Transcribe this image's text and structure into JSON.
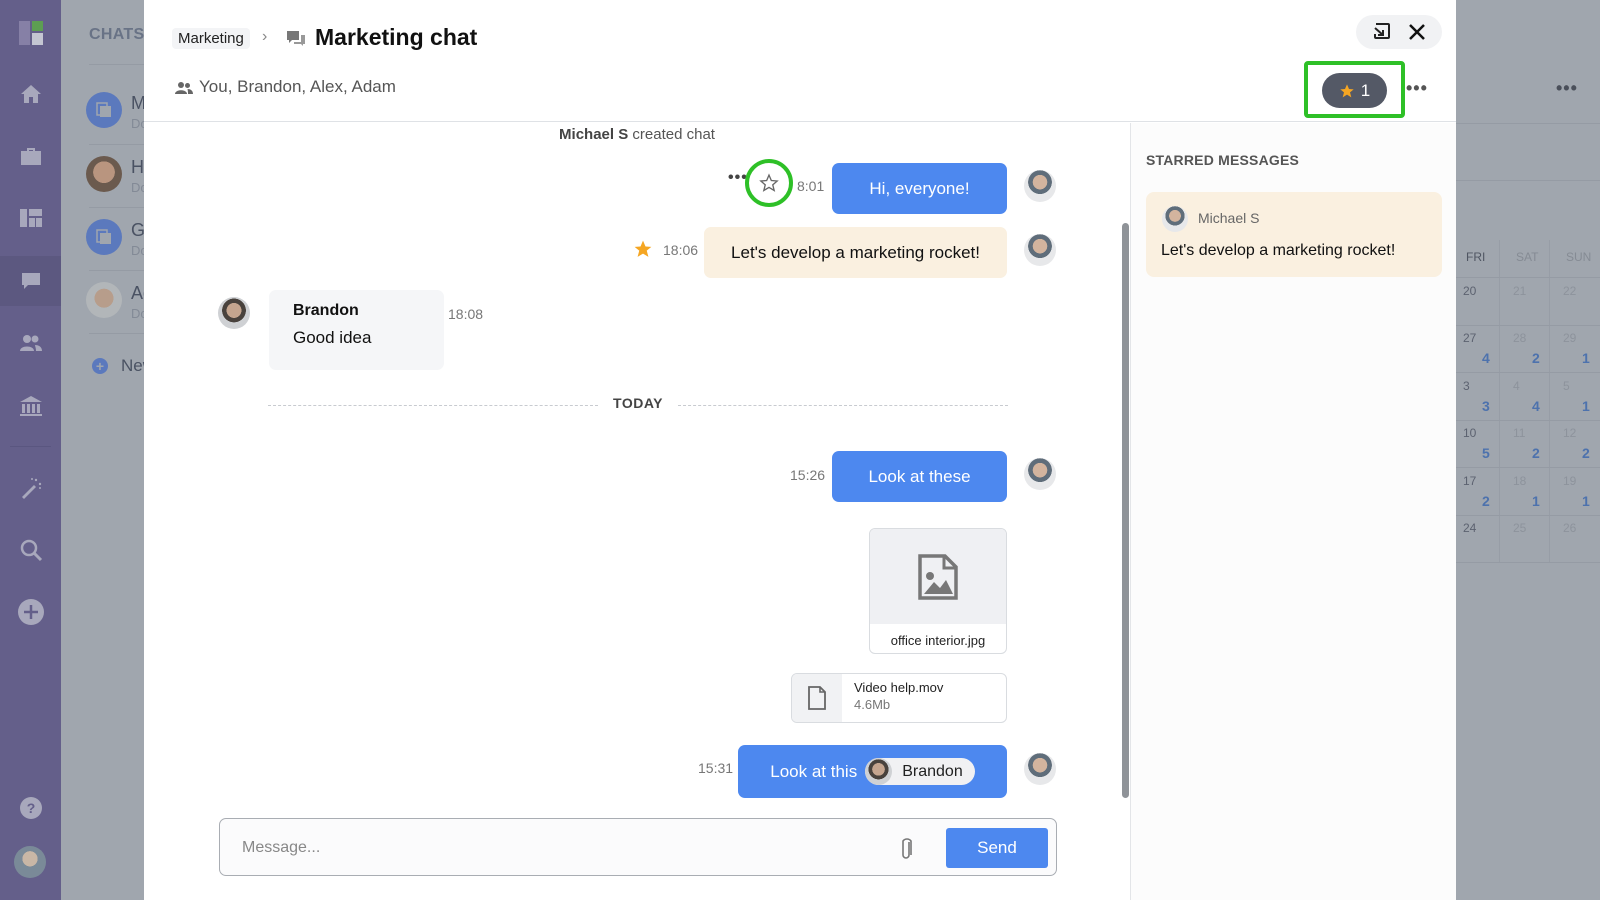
{
  "rail": {
    "items": [
      "logo",
      "home",
      "briefcase",
      "boards",
      "chats",
      "people",
      "bank",
      "magic-wand",
      "search",
      "add",
      "help",
      "profile"
    ],
    "active": "chats"
  },
  "chatlist": {
    "header": "CHATS",
    "items": [
      {
        "name": "M",
        "sub": "Do",
        "type": "group"
      },
      {
        "name": "H",
        "sub": "Do",
        "type": "photo"
      },
      {
        "name": "G",
        "sub": "Do",
        "type": "group"
      },
      {
        "name": "Ad",
        "sub": "Do",
        "type": "photo"
      }
    ],
    "new_label": "New"
  },
  "calendar": {
    "more": "•••",
    "days_of_week": [
      "FRI",
      "SAT",
      "SUN"
    ],
    "weeks": [
      {
        "days": [
          "20",
          "21",
          "22"
        ],
        "counts": [
          "",
          "",
          ""
        ]
      },
      {
        "days": [
          "27",
          "28",
          "29"
        ],
        "counts": [
          "4",
          "2",
          "1"
        ]
      },
      {
        "days": [
          "3",
          "4",
          "5"
        ],
        "counts": [
          "3",
          "4",
          "1"
        ]
      },
      {
        "days": [
          "10",
          "11",
          "12"
        ],
        "counts": [
          "5",
          "2",
          "2"
        ]
      },
      {
        "days": [
          "17",
          "18",
          "19"
        ],
        "counts": [
          "2",
          "1",
          "1"
        ]
      },
      {
        "days": [
          "24",
          "25",
          "26"
        ],
        "counts": [
          "",
          "",
          ""
        ]
      }
    ]
  },
  "header": {
    "breadcrumb": "Marketing",
    "title": "Marketing chat",
    "members": "You, Brandon, Alex, Adam",
    "starred_count": "1",
    "more": "•••"
  },
  "messages": {
    "system": {
      "author": "Michael S",
      "text": " created chat"
    },
    "m1": {
      "text": "Hi, everyone!",
      "time": "8:01",
      "more": "•••"
    },
    "m2": {
      "text": "Let's develop a marketing rocket!",
      "time": "18:06",
      "starred": true
    },
    "m3": {
      "author": "Brandon",
      "text": "Good idea",
      "time": "18:08"
    },
    "separator": "TODAY",
    "m4": {
      "text": "Look at these",
      "time": "15:26"
    },
    "attachment_image": {
      "name": "office interior.jpg"
    },
    "attachment_file": {
      "name": "Video help.mov",
      "size": "4.6Mb"
    },
    "m5": {
      "text": "Look at this",
      "mention": "Brandon",
      "time": "15:31"
    }
  },
  "composer": {
    "placeholder": "Message...",
    "send_label": "Send"
  },
  "starred_panel": {
    "title": "STARRED MESSAGES",
    "items": [
      {
        "author": "Michael S",
        "text": "Let's develop a marketing rocket!"
      }
    ]
  },
  "colors": {
    "accent": "#4d88ef",
    "starred_bg": "#faf0e0",
    "star": "#f5a623",
    "highlight": "#2ec027",
    "rail": "#645f8a"
  }
}
